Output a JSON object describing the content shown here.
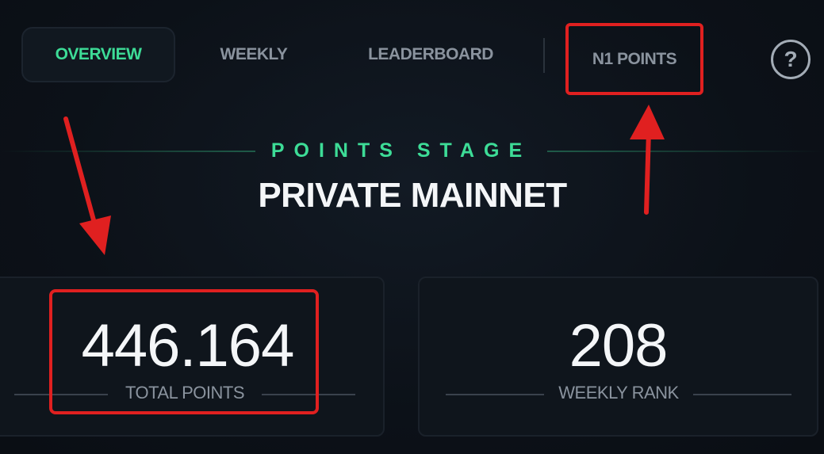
{
  "nav": {
    "tabs": [
      {
        "label": "OVERVIEW",
        "active": true
      },
      {
        "label": "WEEKLY",
        "active": false
      },
      {
        "label": "LEADERBOARD",
        "active": false
      },
      {
        "label": "N1 POINTS",
        "active": false
      }
    ],
    "help_icon": "question-circle-icon"
  },
  "stage": {
    "eyebrow": "POINTS STAGE",
    "title": "PRIVATE MAINNET"
  },
  "stats": {
    "total_points": {
      "value": "446.164",
      "label": "TOTAL POINTS"
    },
    "weekly_rank": {
      "value": "208",
      "label": "WEEKLY RANK"
    }
  },
  "colors": {
    "accent": "#3ddc97",
    "annotation": "#e02020",
    "background": "#0c1118"
  }
}
